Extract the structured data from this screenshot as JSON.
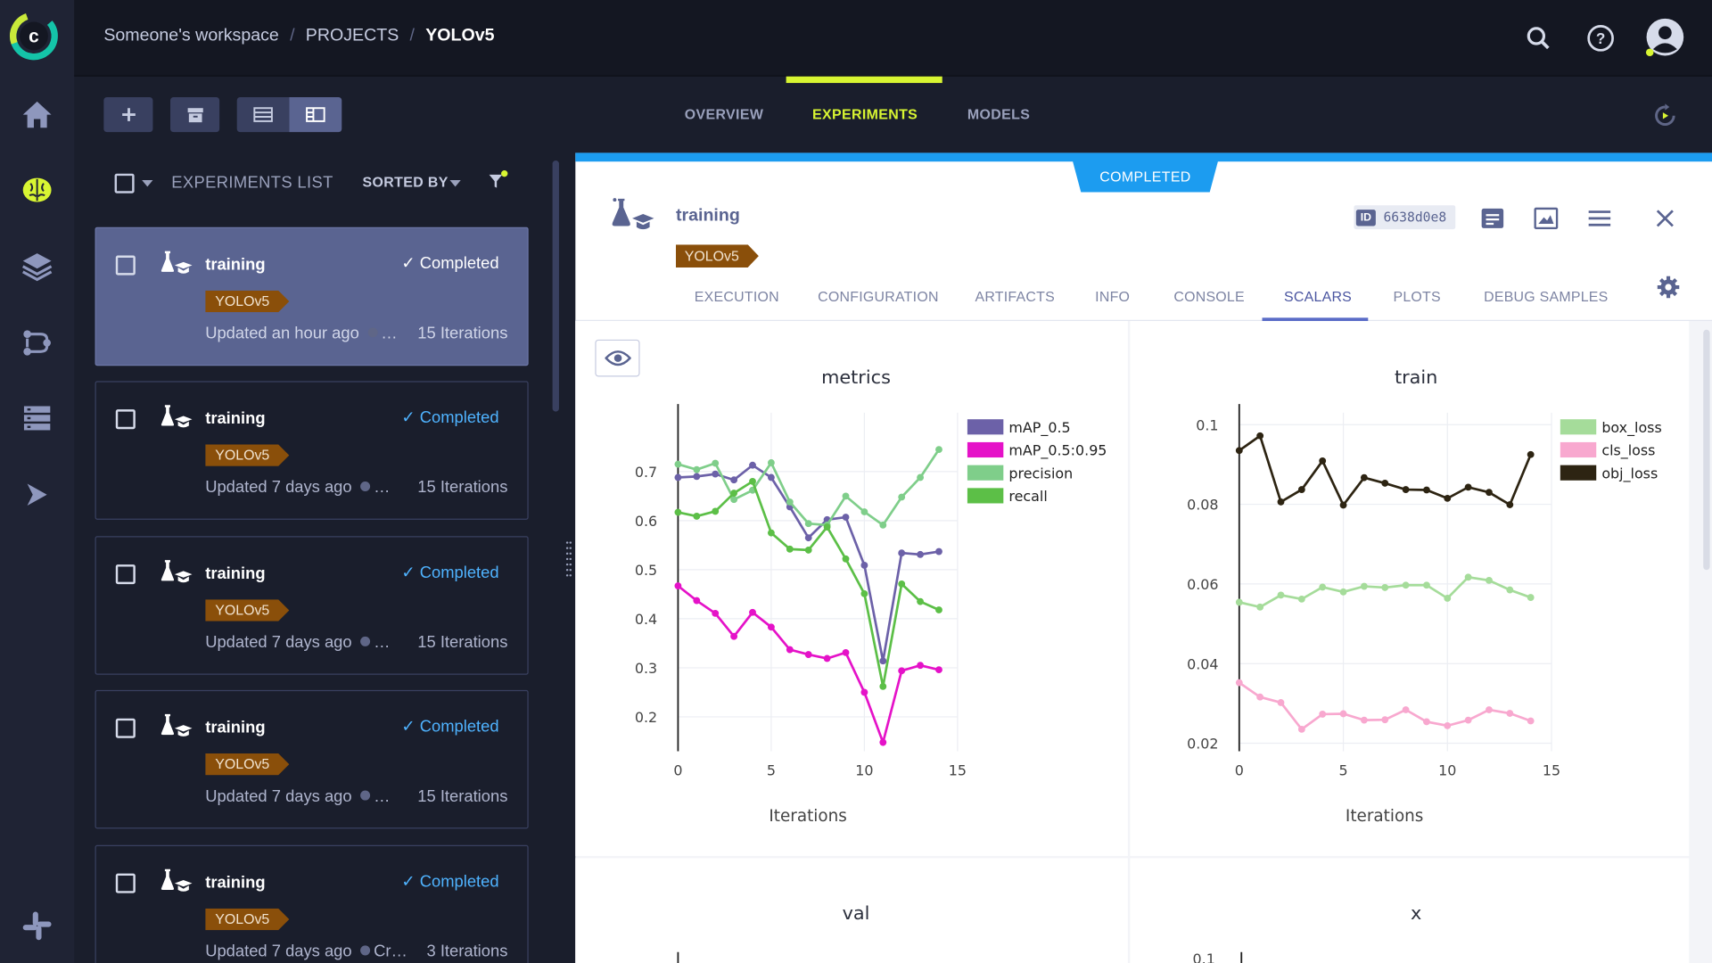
{
  "workspace": {
    "breadcrumb": [
      "Someone's workspace",
      "PROJECTS",
      "YOLOv5"
    ]
  },
  "project_tabs": [
    {
      "label": "OVERVIEW",
      "active": false
    },
    {
      "label": "EXPERIMENTS",
      "active": true
    },
    {
      "label": "MODELS",
      "active": false
    }
  ],
  "list": {
    "title": "EXPERIMENTS LIST",
    "sorted_by": "SORTED BY",
    "items": [
      {
        "name": "training",
        "status": "✓ Completed",
        "tag": "YOLOv5",
        "updated": "Updated an hour ago",
        "user": "…",
        "iterations": "15 Iterations",
        "selected": true
      },
      {
        "name": "training",
        "status": "✓ Completed",
        "tag": "YOLOv5",
        "updated": "Updated 7 days ago",
        "user": "…",
        "iterations": "15 Iterations",
        "selected": false
      },
      {
        "name": "training",
        "status": "✓ Completed",
        "tag": "YOLOv5",
        "updated": "Updated 7 days ago",
        "user": "…",
        "iterations": "15 Iterations",
        "selected": false
      },
      {
        "name": "training",
        "status": "✓ Completed",
        "tag": "YOLOv5",
        "updated": "Updated 7 days ago",
        "user": "…",
        "iterations": "15 Iterations",
        "selected": false
      },
      {
        "name": "training",
        "status": "✓ Completed",
        "tag": "YOLOv5",
        "updated": "Updated 7 days ago",
        "user": "Cr…",
        "iterations": "3 Iterations",
        "selected": false
      }
    ]
  },
  "details": {
    "status_ribbon": "COMPLETED",
    "name": "training",
    "tag": "YOLOv5",
    "id_label": "ID",
    "id_value": "6638d0e8",
    "tabs": [
      "EXECUTION",
      "CONFIGURATION",
      "ARTIFACTS",
      "INFO",
      "CONSOLE",
      "SCALARS",
      "PLOTS",
      "DEBUG SAMPLES"
    ],
    "active_tab": "SCALARS"
  },
  "colors": {
    "accent": "#d8f532",
    "status_blue": "#1c9cf0",
    "tag_brown": "#8a4f0a",
    "mAP_0.5": "#6c61a8",
    "mAP_0.5:0.95": "#e512c8",
    "precision": "#7fce8a",
    "recall": "#5cbf47",
    "box_loss": "#a5dc9a",
    "cls_loss": "#f8a8cf",
    "obj_loss": "#2d2412"
  },
  "chart_data": [
    {
      "type": "line",
      "title": "metrics",
      "xlabel": "Iterations",
      "xlim": [
        0,
        15
      ],
      "xticks": [
        0,
        5,
        10,
        15
      ],
      "ylim": [
        0.13,
        0.82
      ],
      "yticks": [
        "0.2",
        "0.3",
        "0.4",
        "0.5",
        "0.6",
        "0.7"
      ],
      "legend": "top-right",
      "x": [
        0,
        1,
        2,
        3,
        4,
        5,
        6,
        7,
        8,
        9,
        10,
        11,
        12,
        13,
        14
      ],
      "series": [
        {
          "name": "mAP_0.5",
          "values": [
            0.688,
            0.69,
            0.695,
            0.683,
            0.713,
            0.688,
            0.628,
            0.565,
            0.602,
            0.607,
            0.509,
            0.314,
            0.534,
            0.531,
            0.537
          ]
        },
        {
          "name": "mAP_0.5:0.95",
          "values": [
            0.467,
            0.437,
            0.411,
            0.364,
            0.413,
            0.383,
            0.337,
            0.327,
            0.319,
            0.331,
            0.25,
            0.148,
            0.294,
            0.305,
            0.296
          ]
        },
        {
          "name": "precision",
          "values": [
            0.715,
            0.704,
            0.717,
            0.643,
            0.662,
            0.718,
            0.638,
            0.594,
            0.591,
            0.65,
            0.618,
            0.591,
            0.648,
            0.688,
            0.745
          ]
        },
        {
          "name": "recall",
          "values": [
            0.617,
            0.609,
            0.619,
            0.656,
            0.68,
            0.575,
            0.542,
            0.54,
            0.587,
            0.522,
            0.451,
            0.262,
            0.471,
            0.435,
            0.418
          ]
        }
      ]
    },
    {
      "type": "line",
      "title": "train",
      "xlabel": "Iterations",
      "xlim": [
        0,
        15
      ],
      "xticks": [
        0,
        5,
        10,
        15
      ],
      "ylim": [
        0.018,
        0.103
      ],
      "yticks": [
        "0.02",
        "0.04",
        "0.06",
        "0.08",
        "0.1"
      ],
      "legend": "top-right",
      "x": [
        0,
        1,
        2,
        3,
        4,
        5,
        6,
        7,
        8,
        9,
        10,
        11,
        12,
        13,
        14
      ],
      "series": [
        {
          "name": "box_loss",
          "values": [
            0.0554,
            0.0542,
            0.0572,
            0.0562,
            0.0592,
            0.058,
            0.0594,
            0.0591,
            0.0597,
            0.0597,
            0.0564,
            0.0617,
            0.0609,
            0.0585,
            0.0566
          ]
        },
        {
          "name": "cls_loss",
          "values": [
            0.0352,
            0.0316,
            0.0302,
            0.0235,
            0.0273,
            0.0274,
            0.0258,
            0.0259,
            0.0284,
            0.0254,
            0.0244,
            0.0258,
            0.0284,
            0.0275,
            0.0256
          ]
        },
        {
          "name": "obj_loss",
          "values": [
            0.0935,
            0.0972,
            0.0806,
            0.0837,
            0.0909,
            0.0798,
            0.0867,
            0.0853,
            0.0837,
            0.0836,
            0.0815,
            0.0843,
            0.083,
            0.0799,
            0.0925
          ]
        }
      ]
    }
  ],
  "lower_charts": [
    {
      "title": "val",
      "ytick_visible": ""
    },
    {
      "title": "x",
      "ytick_visible": "0.1"
    }
  ]
}
